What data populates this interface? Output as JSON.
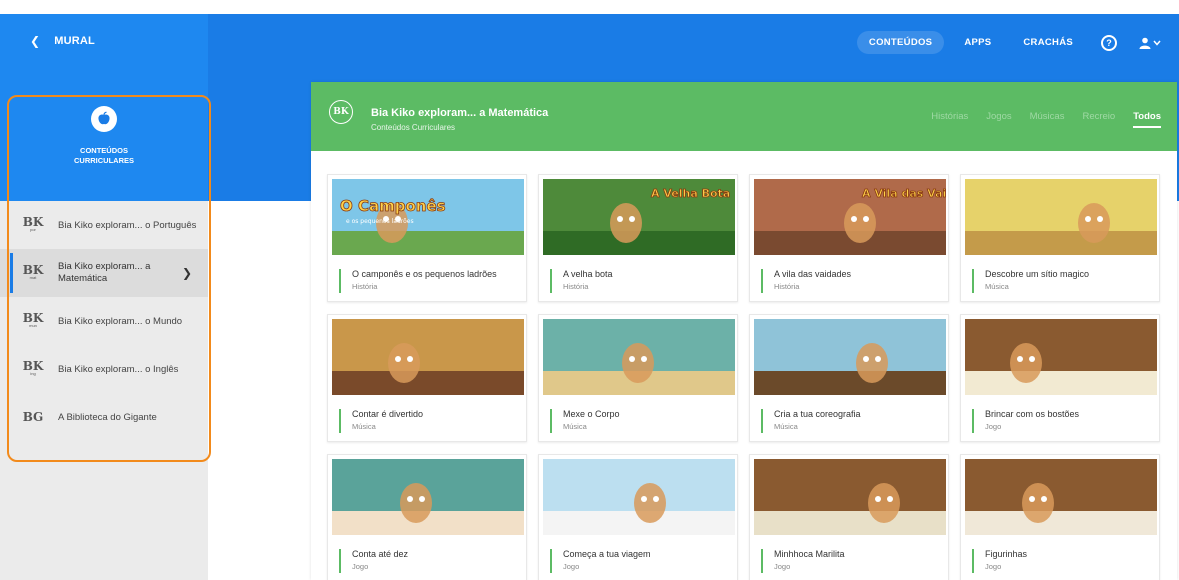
{
  "nav": {
    "back_label": "MURAL",
    "items": [
      {
        "label": "CONTEÚDOS",
        "active": true
      },
      {
        "label": "APPS",
        "active": false
      },
      {
        "label": "CRACHÁS",
        "active": false
      }
    ],
    "help_symbol": "?"
  },
  "sidebar": {
    "category_title": "CONTEÚDOS CURRICULARES",
    "items": [
      {
        "logo": "BK",
        "logo_sub": "por",
        "label": "Bia Kiko exploram... o Português",
        "active": false
      },
      {
        "logo": "BK",
        "logo_sub": "mat",
        "label": "Bia Kiko exploram... a Matemática",
        "active": true
      },
      {
        "logo": "BK",
        "logo_sub": "mun",
        "label": "Bia Kiko exploram... o Mundo",
        "active": false
      },
      {
        "logo": "BK",
        "logo_sub": "ing",
        "label": "Bia Kiko exploram... o Inglês",
        "active": false
      },
      {
        "logo": "BG",
        "logo_sub": "",
        "label": "A Biblioteca do Gigante",
        "active": false
      }
    ]
  },
  "panel": {
    "logo": "BK",
    "title": "Bia Kiko exploram... a Matemática",
    "subtitle": "Conteúdos Curriculares",
    "tabs": [
      {
        "label": "Histórias",
        "active": false
      },
      {
        "label": "Jogos",
        "active": false
      },
      {
        "label": "Músicas",
        "active": false
      },
      {
        "label": "Recreio",
        "active": false
      },
      {
        "label": "Todos",
        "active": true
      }
    ]
  },
  "cards": [
    {
      "title": "O camponês e os pequenos ladrões",
      "type": "História",
      "thumb_text": "O Camponês",
      "thumb_sub": "e os pequenos ladrões",
      "bg": "#7ec6e8",
      "ground": "#6aa84f"
    },
    {
      "title": "A velha bota",
      "type": "História",
      "thumb_text": "A Velha Bota",
      "thumb_sub": "",
      "bg": "#4e8a3a",
      "ground": "#2f6b25"
    },
    {
      "title": "A vila das vaidades",
      "type": "História",
      "thumb_text": "A Vila das Vaidades",
      "thumb_sub": "",
      "bg": "#b06a4a",
      "ground": "#7a4a30"
    },
    {
      "title": "Descobre um sítio magico",
      "type": "Música",
      "thumb_text": "",
      "thumb_sub": "",
      "bg": "#e6d26a",
      "ground": "#c49b4a"
    },
    {
      "title": "Contar é divertido",
      "type": "Música",
      "thumb_text": "",
      "thumb_sub": "",
      "bg": "#c9974a",
      "ground": "#7a4a2a"
    },
    {
      "title": "Mexe o Corpo",
      "type": "Música",
      "thumb_text": "",
      "thumb_sub": "",
      "bg": "#6cb1a8",
      "ground": "#e0c88a"
    },
    {
      "title": "Cria a tua coreografia",
      "type": "Música",
      "thumb_text": "",
      "thumb_sub": "",
      "bg": "#8fc3d8",
      "ground": "#6b4a2a"
    },
    {
      "title": "Brincar com os bostões",
      "type": "Jogo",
      "thumb_text": "",
      "thumb_sub": "",
      "bg": "#8a5a30",
      "ground": "#f2ead2"
    },
    {
      "title": "Conta até dez",
      "type": "Jogo",
      "thumb_text": "",
      "thumb_sub": "",
      "bg": "#5aa39a",
      "ground": "#f2e0c8"
    },
    {
      "title": "Começa a tua viagem",
      "type": "Jogo",
      "thumb_text": "",
      "thumb_sub": "",
      "bg": "#bcdff0",
      "ground": "#f4f4f4"
    },
    {
      "title": "Minhhoca Marilita",
      "type": "Jogo",
      "thumb_text": "",
      "thumb_sub": "",
      "bg": "#8a5a30",
      "ground": "#e8e0c8"
    },
    {
      "title": "Figurinhas",
      "type": "Jogo",
      "thumb_text": "",
      "thumb_sub": "",
      "bg": "#8a5a30",
      "ground": "#f0e8d8"
    }
  ],
  "colors": {
    "topbar": "#1a7ce6",
    "panel_header": "#5cbb64",
    "highlight": "#f28a1b",
    "sidebar_body": "#ebebeb"
  }
}
